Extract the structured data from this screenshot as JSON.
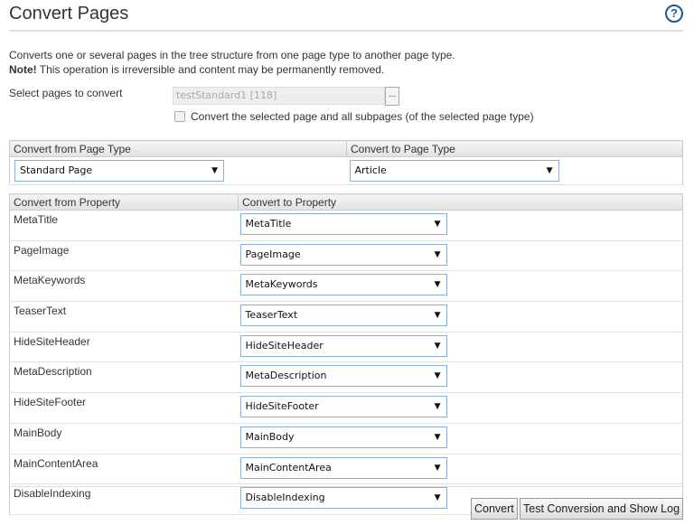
{
  "title": "Convert Pages",
  "help": "?",
  "description": "Converts one or several pages in the tree structure from one page type to another page type.",
  "note_bold": "Note!",
  "note": " This operation is irreversible and content may be permanently removed.",
  "select_label": "Select pages to convert",
  "selected_page": "testStandard1 [118]",
  "browse_label": "...",
  "subpages_label": "Convert the selected page and all subpages (of the selected page type)",
  "page_type": {
    "from_header": "Convert from Page Type",
    "to_header": "Convert to Page Type",
    "from": "Standard Page",
    "to": "Article"
  },
  "property": {
    "from_header": "Convert from Property",
    "to_header": "Convert to Property",
    "rows": [
      {
        "from": "MetaTitle",
        "to": "MetaTitle"
      },
      {
        "from": "PageImage",
        "to": "PageImage"
      },
      {
        "from": "MetaKeywords",
        "to": "MetaKeywords"
      },
      {
        "from": "TeaserText",
        "to": "TeaserText"
      },
      {
        "from": "HideSiteHeader",
        "to": "HideSiteHeader"
      },
      {
        "from": "MetaDescription",
        "to": "MetaDescription"
      },
      {
        "from": "HideSiteFooter",
        "to": "HideSiteFooter"
      },
      {
        "from": "MainBody",
        "to": "MainBody"
      },
      {
        "from": "MainContentArea",
        "to": "MainContentArea"
      },
      {
        "from": "DisableIndexing",
        "to": "DisableIndexing"
      }
    ]
  },
  "buttons": {
    "convert": "Convert",
    "test": "Test Conversion and Show Log"
  },
  "arrow": "▼"
}
